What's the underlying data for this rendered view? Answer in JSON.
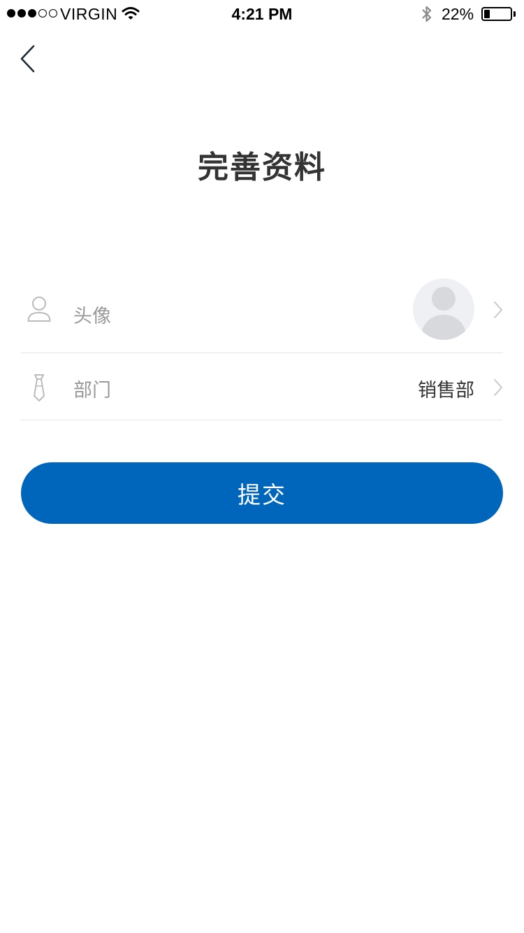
{
  "status_bar": {
    "carrier": "VIRGIN",
    "time": "4:21 PM",
    "battery_percent": "22%",
    "battery_level": 0.22,
    "signal_bars_filled": 3,
    "signal_bars_total": 5,
    "icons": [
      "wifi-icon",
      "bluetooth-icon",
      "battery-icon"
    ]
  },
  "nav": {
    "back_icon": "chevron-left-icon"
  },
  "page": {
    "title": "完善资料"
  },
  "form": {
    "avatar_row": {
      "label": "头像",
      "icon": "user-icon"
    },
    "department_row": {
      "label": "部门",
      "value": "销售部",
      "icon": "tie-icon"
    }
  },
  "actions": {
    "submit_label": "提交"
  },
  "colors": {
    "primary": "#0066bb",
    "title_text": "#333333",
    "label_text": "#999999",
    "divider": "#e6e6e6",
    "avatar_bg": "#eef0f3"
  }
}
